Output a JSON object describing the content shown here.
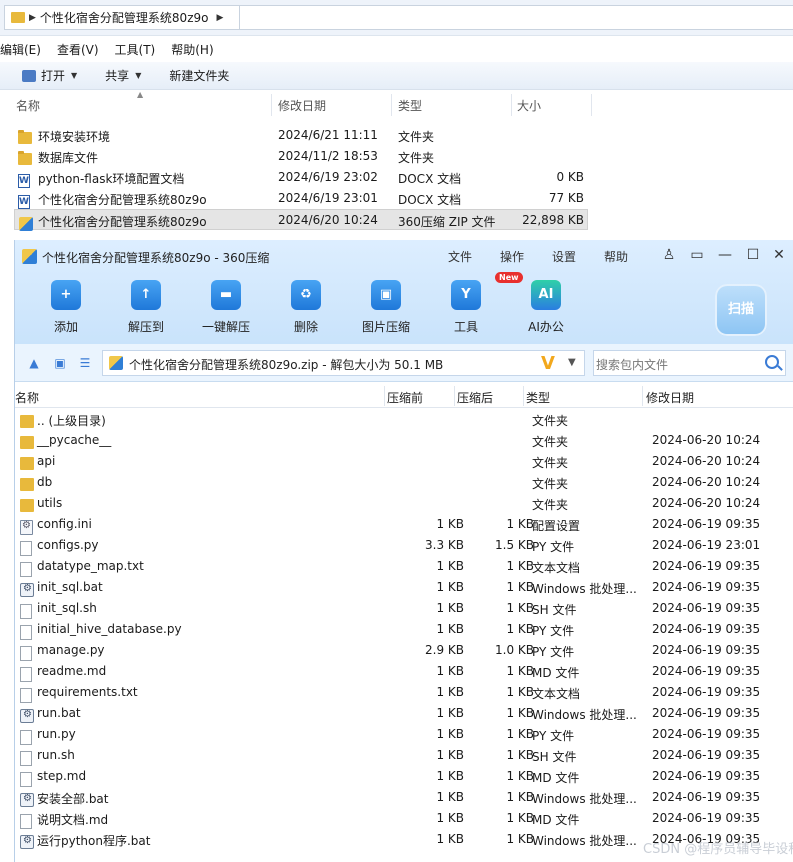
{
  "explorer": {
    "address": "个性化宿舍分配管理系统80z9o",
    "menu": [
      "编辑(E)",
      "查看(V)",
      "工具(T)",
      "帮助(H)"
    ],
    "commands": {
      "open": "打开",
      "share": "共享",
      "new_folder": "新建文件夹"
    },
    "columns": {
      "name": "名称",
      "modified": "修改日期",
      "type": "类型",
      "size": "大小"
    },
    "rows": [
      {
        "icon": "folder-icon",
        "name": "环境安装环境",
        "modified": "2024/6/21 11:11",
        "type": "文件夹",
        "size": ""
      },
      {
        "icon": "folder-icon",
        "name": "数据库文件",
        "modified": "2024/11/2 18:53",
        "type": "文件夹",
        "size": ""
      },
      {
        "icon": "word-doc-icon",
        "name": "python-flask环境配置文档",
        "modified": "2024/6/19 23:02",
        "type": "DOCX 文档",
        "size": "0 KB"
      },
      {
        "icon": "word-doc-icon",
        "name": "个性化宿舍分配管理系统80z9o",
        "modified": "2024/6/19 23:01",
        "type": "DOCX 文档",
        "size": "77 KB"
      },
      {
        "icon": "zip-archive-icon",
        "name": "个性化宿舍分配管理系统80z9o",
        "modified": "2024/6/20 10:24",
        "type": "360压缩 ZIP 文件",
        "size": "22,898 KB"
      }
    ]
  },
  "zip": {
    "title": "个性化宿舍分配管理系统80z9o - 360压缩",
    "menu": [
      "文件",
      "操作",
      "设置",
      "帮助"
    ],
    "tools": [
      {
        "label": "添加",
        "icon": "add-icon"
      },
      {
        "label": "解压到",
        "icon": "extract-to-icon"
      },
      {
        "label": "一键解压",
        "icon": "one-click-extract-icon"
      },
      {
        "label": "删除",
        "icon": "delete-icon"
      },
      {
        "label": "图片压缩",
        "icon": "image-compress-icon"
      },
      {
        "label": "工具",
        "icon": "tools-icon",
        "badge": "New"
      },
      {
        "label": "AI办公",
        "icon": "ai-office-icon",
        "glyph": "AI"
      }
    ],
    "scan_label": "扫描",
    "path_text": "个性化宿舍分配管理系统80z9o.zip - 解包大小为 50.1 MB",
    "search_placeholder": "搜索包内文件",
    "columns": {
      "name": "名称",
      "compressed_before": "压缩前",
      "compressed_after": "压缩后",
      "type": "类型",
      "modified": "修改日期"
    },
    "rows": [
      {
        "icon": "folder",
        "name": ".. (上级目录)",
        "before": "",
        "after": "",
        "type": "文件夹",
        "date": ""
      },
      {
        "icon": "folder",
        "name": "__pycache__",
        "before": "",
        "after": "",
        "type": "文件夹",
        "date": "2024-06-20 10:24"
      },
      {
        "icon": "folder",
        "name": "api",
        "before": "",
        "after": "",
        "type": "文件夹",
        "date": "2024-06-20 10:24"
      },
      {
        "icon": "folder",
        "name": "db",
        "before": "",
        "after": "",
        "type": "文件夹",
        "date": "2024-06-20 10:24"
      },
      {
        "icon": "folder",
        "name": "utils",
        "before": "",
        "after": "",
        "type": "文件夹",
        "date": "2024-06-20 10:24"
      },
      {
        "icon": "config",
        "name": "config.ini",
        "before": "1 KB",
        "after": "1 KB",
        "type": "配置设置",
        "date": "2024-06-19 09:35"
      },
      {
        "icon": "file",
        "name": "configs.py",
        "before": "3.3 KB",
        "after": "1.5 KB",
        "type": "PY 文件",
        "date": "2024-06-19 23:01"
      },
      {
        "icon": "file",
        "name": "datatype_map.txt",
        "before": "1 KB",
        "after": "1 KB",
        "type": "文本文档",
        "date": "2024-06-19 09:35"
      },
      {
        "icon": "bat",
        "name": "init_sql.bat",
        "before": "1 KB",
        "after": "1 KB",
        "type": "Windows 批处理...",
        "date": "2024-06-19 09:35"
      },
      {
        "icon": "file",
        "name": "init_sql.sh",
        "before": "1 KB",
        "after": "1 KB",
        "type": "SH 文件",
        "date": "2024-06-19 09:35"
      },
      {
        "icon": "file",
        "name": "initial_hive_database.py",
        "before": "1 KB",
        "after": "1 KB",
        "type": "PY 文件",
        "date": "2024-06-19 09:35"
      },
      {
        "icon": "file",
        "name": "manage.py",
        "before": "2.9 KB",
        "after": "1.0 KB",
        "type": "PY 文件",
        "date": "2024-06-19 09:35"
      },
      {
        "icon": "file",
        "name": "readme.md",
        "before": "1 KB",
        "after": "1 KB",
        "type": "MD 文件",
        "date": "2024-06-19 09:35"
      },
      {
        "icon": "file",
        "name": "requirements.txt",
        "before": "1 KB",
        "after": "1 KB",
        "type": "文本文档",
        "date": "2024-06-19 09:35"
      },
      {
        "icon": "bat",
        "name": "run.bat",
        "before": "1 KB",
        "after": "1 KB",
        "type": "Windows 批处理...",
        "date": "2024-06-19 09:35"
      },
      {
        "icon": "file",
        "name": "run.py",
        "before": "1 KB",
        "after": "1 KB",
        "type": "PY 文件",
        "date": "2024-06-19 09:35"
      },
      {
        "icon": "file",
        "name": "run.sh",
        "before": "1 KB",
        "after": "1 KB",
        "type": "SH 文件",
        "date": "2024-06-19 09:35"
      },
      {
        "icon": "file",
        "name": "step.md",
        "before": "1 KB",
        "after": "1 KB",
        "type": "MD 文件",
        "date": "2024-06-19 09:35"
      },
      {
        "icon": "bat",
        "name": "安装全部.bat",
        "before": "1 KB",
        "after": "1 KB",
        "type": "Windows 批处理...",
        "date": "2024-06-19 09:35"
      },
      {
        "icon": "file",
        "name": "说明文档.md",
        "before": "1 KB",
        "after": "1 KB",
        "type": "MD 文件",
        "date": "2024-06-19 09:35"
      },
      {
        "icon": "bat",
        "name": "运行python程序.bat",
        "before": "1 KB",
        "after": "1 KB",
        "type": "Windows 批处理...",
        "date": "2024-06-19 09:35"
      }
    ]
  },
  "watermark": "CSDN @程序员辅导毕设程序"
}
